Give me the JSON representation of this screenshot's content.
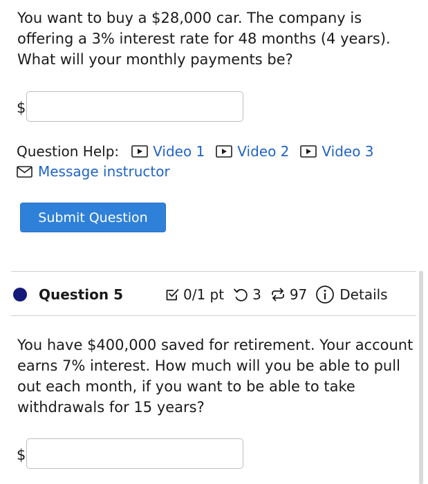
{
  "question4": {
    "text": "You want to buy a $28,000 car. The company is offering a 3% interest rate for 48 months (4 years). What will your monthly payments be?",
    "currency_symbol": "$",
    "answer_value": ""
  },
  "help": {
    "label": "Question Help:",
    "video1": "Video 1",
    "video2": "Video 2",
    "video3": "Video 3",
    "message": "Message instructor"
  },
  "submit_label": "Submit Question",
  "question5": {
    "title": "Question 5",
    "score": "0/1 pt",
    "retries": "3",
    "attempts": "97",
    "details": "Details",
    "text": "You have $400,000 saved for retirement. Your account earns 7% interest. How much will you be able to pull out each month, if you want to be able to take withdrawals for 15 years?",
    "currency_symbol": "$",
    "answer_value": ""
  },
  "colors": {
    "link": "#1f63c7",
    "button": "#2f80d8",
    "status_dot": "#15197a"
  },
  "icons": {
    "video": "play-box-icon",
    "message": "envelope-icon",
    "score": "checkbox-icon",
    "retries": "undo-icon",
    "attempts": "repeat-icon",
    "details": "info-circle-icon"
  }
}
